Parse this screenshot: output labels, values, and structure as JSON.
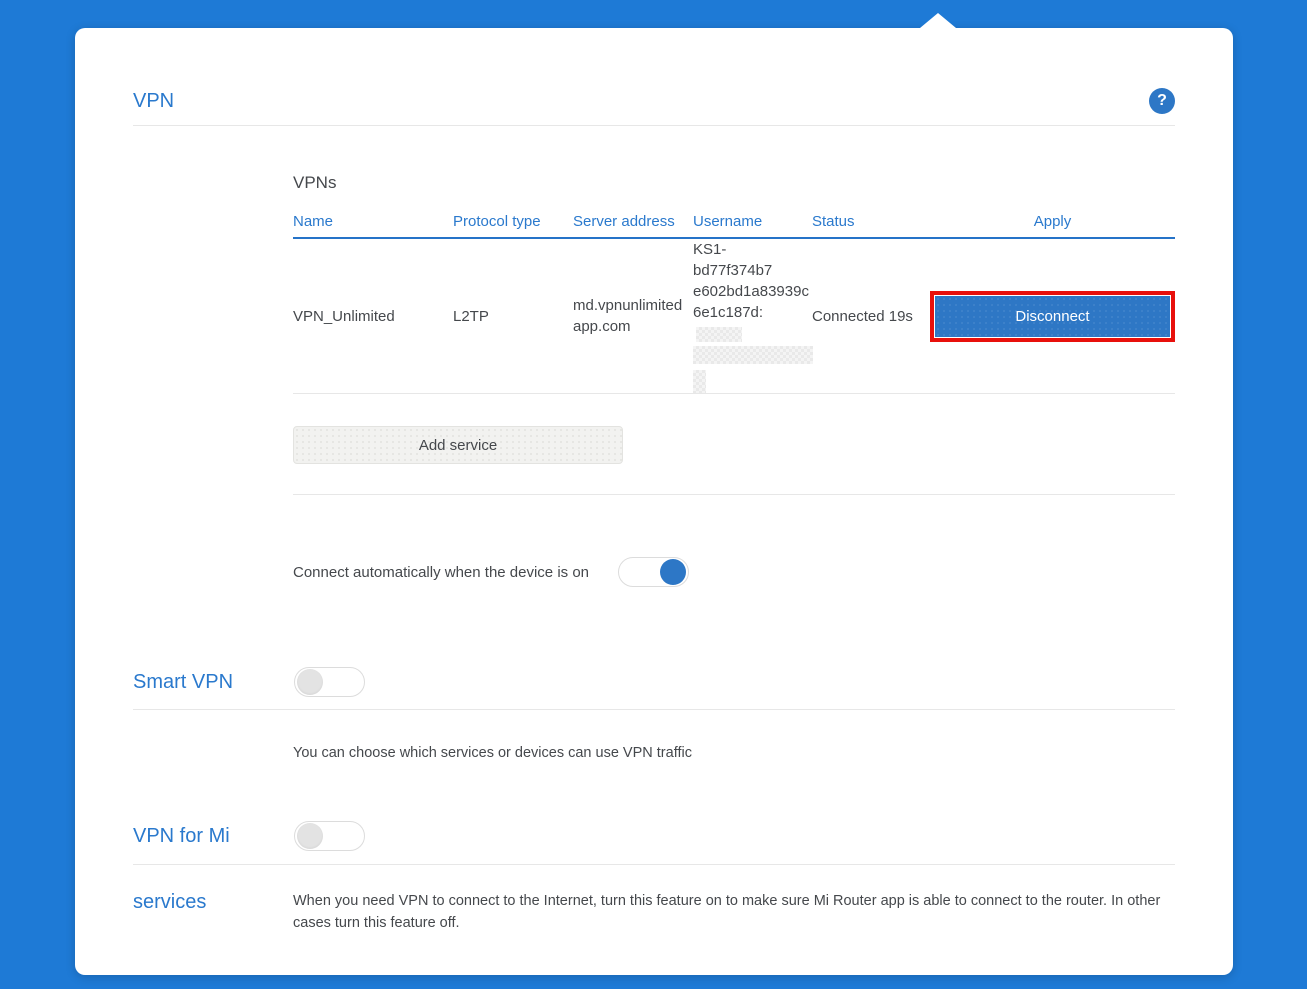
{
  "window": {
    "title": "VPN",
    "help_icon_glyph": "?"
  },
  "vpns_section": {
    "heading": "VPNs",
    "table": {
      "headers": {
        "name": "Name",
        "protocol": "Protocol type",
        "server": "Server address",
        "username": "Username",
        "status": "Status",
        "apply": "Apply"
      },
      "row": {
        "name": "VPN_Unlimited",
        "protocol": "L2TP",
        "server_address": "md.vpnunlimitedapp.com",
        "username_lines": [
          "KS1-bd77f374b7",
          "e602bd1a83939c",
          "6e1c187d:"
        ],
        "username_partially_redacted": true,
        "status": "Connected 19s",
        "apply_button_label": "Disconnect",
        "apply_button_highlighted": true
      }
    },
    "add_service_button": "Add service"
  },
  "auto_connect": {
    "label": "Connect automatically when the device is on",
    "state": "on"
  },
  "smart_vpn": {
    "label": "Smart VPN",
    "state": "off",
    "description": "You can choose which services or devices can use VPN traffic"
  },
  "vpn_for_mi_services": {
    "label_line1": "VPN for Mi",
    "label_line2": "services",
    "state": "off",
    "description": "When you need VPN to connect to the Internet, turn this feature on to make sure Mi Router app is able to connect to the router. In other cases turn this feature off."
  },
  "colors": {
    "background_blue": "#1e7ad6",
    "accent_blue": "#2a79cd",
    "button_blue": "#2e77c5",
    "table_underline_blue": "#2573c8",
    "highlight_red": "#e8100c",
    "divider_gray": "#e7e7e7",
    "body_text": "#45484c"
  }
}
